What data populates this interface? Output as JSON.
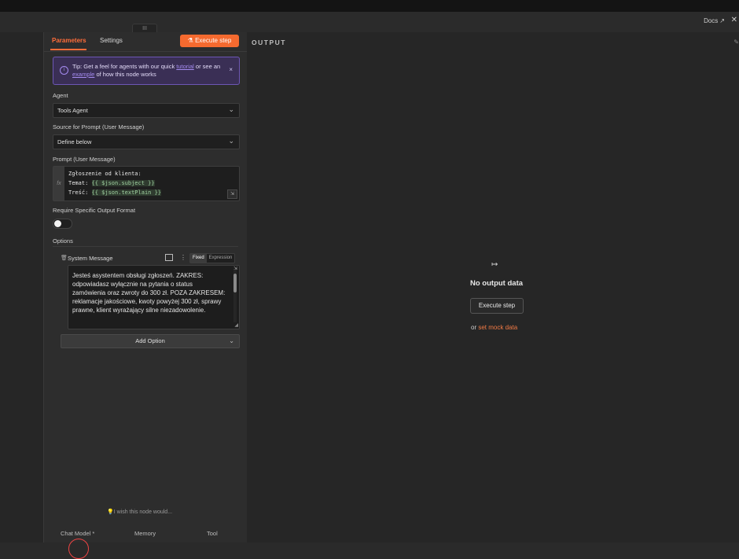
{
  "header": {
    "docs_label": "Docs",
    "docs_icon": "external-link-icon",
    "close_icon": "close-icon",
    "drag_label": "III"
  },
  "tabs": [
    {
      "label": "Parameters",
      "active": true
    },
    {
      "label": "Settings",
      "active": false
    }
  ],
  "execute_step_label": "Execute step",
  "tip": {
    "prefix": "Tip: Get a feel for agents with our quick ",
    "link1": "tutorial",
    "middle": " or see an ",
    "link2": "example",
    "suffix": " of how this node works",
    "close": "×"
  },
  "agent": {
    "label": "Agent",
    "value": "Tools Agent"
  },
  "source": {
    "label": "Source for Prompt (User Message)",
    "value": "Define below"
  },
  "prompt": {
    "label": "Prompt (User Message)",
    "fx": "fx",
    "line1": "Zgłoszenie od klienta:",
    "line2_prefix": "Temat: ",
    "line2_expr": "{{ $json.subject }}",
    "line3_prefix": "Treść: ",
    "line3_expr": "{{ $json.textPlain }}"
  },
  "require_format": {
    "label": "Require Specific Output Format",
    "enabled": false
  },
  "options": {
    "label": "Options",
    "system_message": {
      "title": "System Message",
      "mode_fixed": "Fixed",
      "mode_expression": "Expression",
      "active_mode": "Fixed",
      "text": "Jesteś asystentem obsługi zgłoszeń. ZAKRES: odpowiadasz wyłącznie na pytania o status zamówienia oraz zwroty do 300 zł. POZA ZAKRESEM: reklamacje jakościowe, kwoty powyżej 300 zł, sprawy prawne, klient wyrażający silne niezadowolenie."
    },
    "add_option_label": "Add Option"
  },
  "wish_text": "I wish this node would...",
  "bottom_tabs": [
    "Chat Model *",
    "Memory",
    "Tool"
  ],
  "output": {
    "title": "OUTPUT",
    "no_output": "No output data",
    "execute_label": "Execute step",
    "or_text": "or ",
    "mock_link": "set mock data"
  },
  "colors": {
    "accent": "#f56a2f",
    "tip_bg": "#3a2f55",
    "tip_border": "#6d56b5",
    "link": "#a58bf0"
  }
}
